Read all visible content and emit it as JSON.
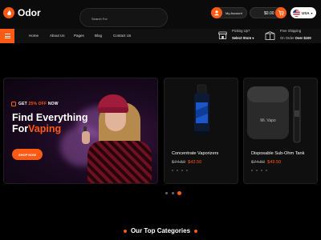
{
  "brand": {
    "name": "Odor",
    "accent": "#ff5a13"
  },
  "search": {
    "placeholder": "Search For"
  },
  "header": {
    "account_label": "My Account",
    "cart_total": "$0.00",
    "language": "USA"
  },
  "nav": {
    "items": [
      {
        "label": "Home"
      },
      {
        "label": "About Us"
      },
      {
        "label": "Pages"
      },
      {
        "label": "Blog"
      },
      {
        "label": "Contact Us"
      }
    ]
  },
  "pickup": {
    "title": "Picking Up?",
    "select_label": "Select Store"
  },
  "shipping": {
    "title": "Free Shipping",
    "prefix": "On Order",
    "amount": "Over $100"
  },
  "hero": {
    "promo_prefix": "GET",
    "promo_highlight": "25% OFF",
    "promo_suffix": "NOW",
    "title_line1": "Find Everything",
    "title_line2_a": "For",
    "title_line2_b": "Vaping",
    "cta": "SHOP NOW"
  },
  "products": [
    {
      "name": "Concentrate Vaporizers",
      "old_price": "$74.50",
      "price": "$43.50"
    },
    {
      "name": "Disposable Sub-Ohm Tank",
      "old_price": "$74.50",
      "price": "$49.50",
      "device_label": "Mi. Vapo"
    }
  ],
  "slider": {
    "count": 3,
    "active_index": 2
  },
  "section": {
    "title": "Our Top Categories"
  }
}
